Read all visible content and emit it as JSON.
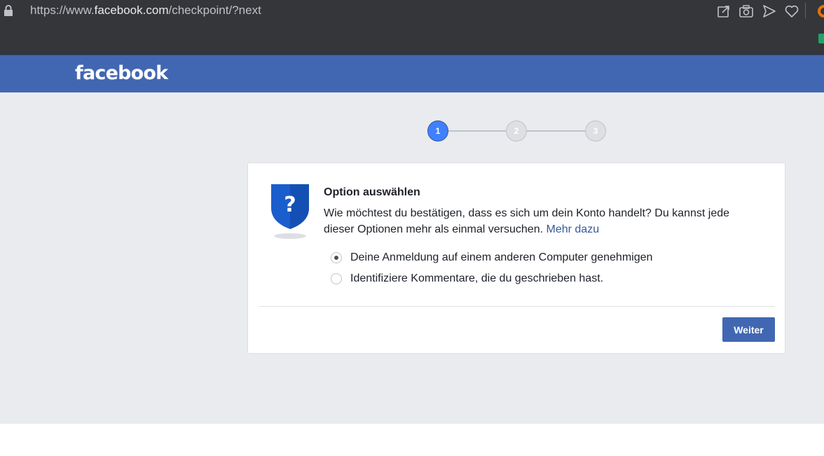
{
  "browser": {
    "url_prefix": "https://www.",
    "url_host": "facebook.com",
    "url_path": "/checkpoint/?next",
    "icons": [
      "lock-icon",
      "share-icon",
      "camera-icon",
      "send-icon",
      "heart-icon"
    ]
  },
  "header": {
    "logo": "facebook",
    "bg_color": "#4267b2"
  },
  "stepper": {
    "steps": [
      "1",
      "2",
      "3"
    ],
    "active_step": 1
  },
  "card": {
    "title": "Option auswählen",
    "description": "Wie möchtest du bestätigen, dass es sich um dein Konto handelt? Du kannst jede dieser Optionen mehr als einmal versuchen.",
    "more_link": "Mehr dazu",
    "options": [
      {
        "label": "Deine Anmeldung auf einem anderen Computer genehmigen",
        "selected": true
      },
      {
        "label": "Identifiziere Kommentare, die du geschrieben hast.",
        "selected": false
      }
    ],
    "continue_label": "Weiter"
  }
}
